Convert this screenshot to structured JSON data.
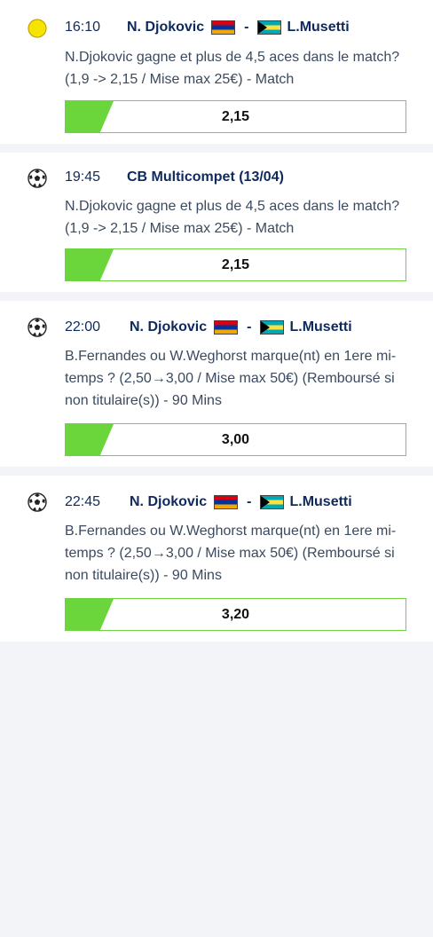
{
  "bets": [
    {
      "sport": "tennis-ball-icon",
      "time": "16:10",
      "home": "N. Djokovic",
      "separator": "-",
      "away": "L.Musetti",
      "description": "N.Djokovic gagne et plus de 4,5 aces dans le match? (1,9 -> 2,15 / Mise max 25€) - Match",
      "odds": "2,15"
    },
    {
      "sport": "soccer-ball-icon",
      "time": "19:45",
      "event": "CB Multicompet (13/04)",
      "description": "N.Djokovic gagne et plus de 4,5 aces dans le match? (1,9 -> 2,15 / Mise max 25€) - Match",
      "odds": "2,15"
    },
    {
      "sport": "soccer-ball-icon",
      "time": "22:00",
      "home": "N. Djokovic",
      "separator": "-",
      "away": "L.Musetti",
      "description": "B.Fernandes ou W.Weghorst marque(nt) en 1ere mi-temps ? (2,50→3,00 / Mise max 50€) (Remboursé si non titulaire(s)) - 90 Mins",
      "odds": "3,00"
    },
    {
      "sport": "soccer-ball-icon",
      "time": "22:45",
      "home": "N. Djokovic",
      "separator": "-",
      "away": "L.Musetti",
      "description": "B.Fernandes ou W.Weghorst marque(nt) en 1ere mi-temps ? (2,50→3,00 / Mise max 50€) (Remboursé si non titulaire(s)) - 90 Mins",
      "odds": "3,20"
    }
  ],
  "colors": {
    "accent_green": "#6ad63b",
    "title_navy": "#0e2a5c",
    "background": "#f3f4f8"
  }
}
